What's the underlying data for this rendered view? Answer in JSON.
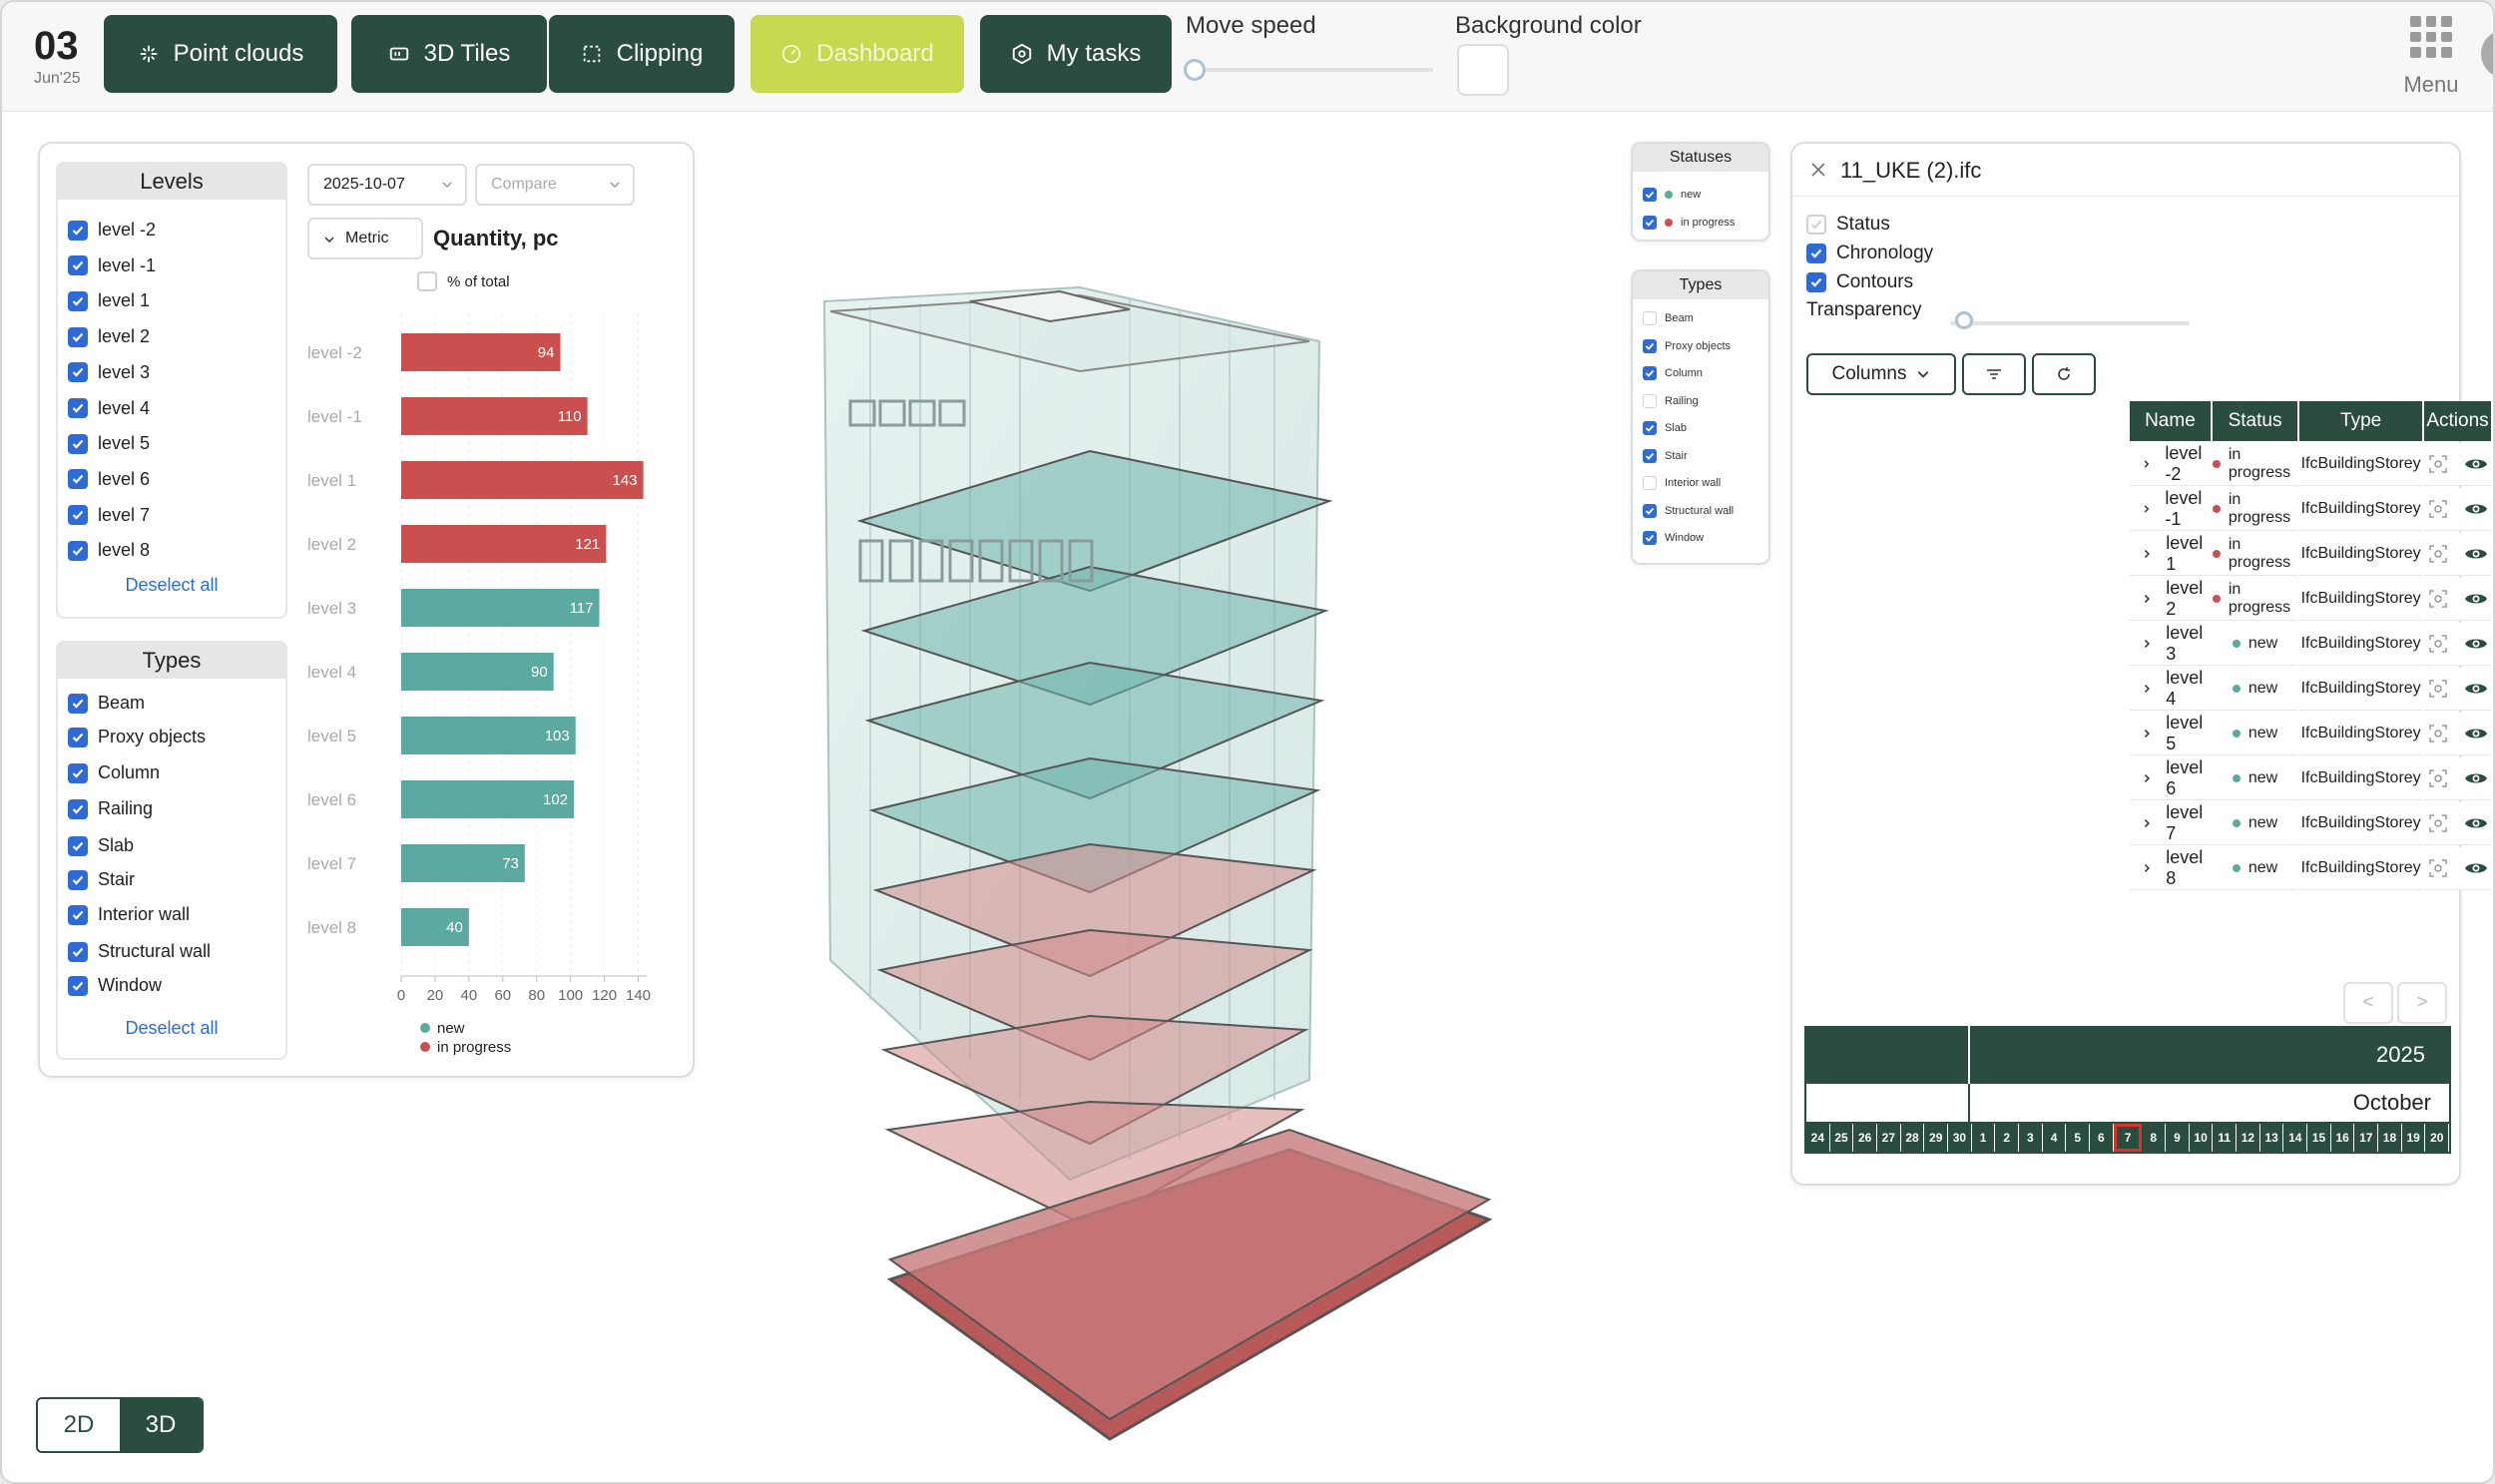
{
  "header": {
    "date_day": "03",
    "date_sub": "Jun'25",
    "nav": [
      {
        "label": "Point clouds",
        "icon": "point-clouds-icon"
      },
      {
        "label": "3D Tiles",
        "icon": "tiles-icon"
      },
      {
        "label": "Clipping",
        "icon": "clipping-icon"
      },
      {
        "label": "Dashboard",
        "icon": "dashboard-icon",
        "active": true
      },
      {
        "label": "My tasks",
        "icon": "tasks-icon"
      }
    ],
    "move_speed_label": "Move speed",
    "move_speed_value": 0.0,
    "background_color_label": "Background color",
    "background_color_value": "#ffffff",
    "menu_label": "Menu"
  },
  "colors": {
    "dark_green": "#2a4d3f",
    "lime": "#c8d94f",
    "new": "#5ba9a0",
    "in_progress": "#c9504f",
    "checkbox": "#2f6bd6"
  },
  "levels_panel": {
    "title": "Levels",
    "items": [
      "level -2",
      "level -1",
      "level 1",
      "level 2",
      "level 3",
      "level 4",
      "level 5",
      "level 6",
      "level 7",
      "level 8"
    ],
    "deselect_label": "Deselect all"
  },
  "types_panel": {
    "title": "Types",
    "items": [
      "Beam",
      "Proxy objects",
      "Column",
      "Railing",
      "Slab",
      "Stair",
      "Interior wall",
      "Structural wall",
      "Window"
    ],
    "deselect_label": "Deselect all"
  },
  "dashboard": {
    "date_value": "2025-10-07",
    "compare_placeholder": "Compare",
    "metric_label": "Metric",
    "metric_title": "Quantity, pc",
    "percent_label": "% of total"
  },
  "chart_data": {
    "type": "bar",
    "orientation": "horizontal",
    "categories": [
      "level -2",
      "level -1",
      "level 1",
      "level 2",
      "level 3",
      "level 4",
      "level 5",
      "level 6",
      "level 7",
      "level 8"
    ],
    "values": [
      94,
      110,
      143,
      121,
      117,
      90,
      103,
      102,
      73,
      40
    ],
    "status": [
      "in progress",
      "in progress",
      "in progress",
      "in progress",
      "new",
      "new",
      "new",
      "new",
      "new",
      "new"
    ],
    "xticks": [
      0,
      20,
      40,
      60,
      80,
      100,
      120,
      140
    ],
    "xlim": [
      0,
      145
    ],
    "grid": true,
    "legend": [
      {
        "name": "new",
        "color": "#5ba9a0"
      },
      {
        "name": "in progress",
        "color": "#c9504f"
      }
    ],
    "legend_position": "bottom-left",
    "title": "Quantity, pc"
  },
  "statuses_panel": {
    "title": "Statuses",
    "items": [
      {
        "label": "new",
        "color": "#5ba9a0"
      },
      {
        "label": "in progress",
        "color": "#c9504f"
      }
    ]
  },
  "types_filter_panel": {
    "title": "Types",
    "items": [
      {
        "label": "Beam",
        "checked": false
      },
      {
        "label": "Proxy objects",
        "checked": true
      },
      {
        "label": "Column",
        "checked": true
      },
      {
        "label": "Railing",
        "checked": false
      },
      {
        "label": "Slab",
        "checked": true
      },
      {
        "label": "Stair",
        "checked": true
      },
      {
        "label": "Interior wall",
        "checked": false
      },
      {
        "label": "Structural wall",
        "checked": true
      },
      {
        "label": "Window",
        "checked": true
      }
    ]
  },
  "details_panel": {
    "file_name": "11_UKE (2).ifc",
    "toggles": [
      {
        "label": "Status",
        "checked": false
      },
      {
        "label": "Chronology",
        "checked": true
      },
      {
        "label": "Contours",
        "checked": true
      }
    ],
    "transparency_label": "Transparency",
    "transparency_value": 0.06,
    "columns_button": "Columns",
    "table": {
      "headers": [
        "Name",
        "Status",
        "Type",
        "Actions"
      ],
      "rows": [
        {
          "name": "level -2",
          "status": "in progress",
          "type": "IfcBuildingStorey"
        },
        {
          "name": "level -1",
          "status": "in progress",
          "type": "IfcBuildingStorey"
        },
        {
          "name": "level 1",
          "status": "in progress",
          "type": "IfcBuildingStorey"
        },
        {
          "name": "level 2",
          "status": "in progress",
          "type": "IfcBuildingStorey"
        },
        {
          "name": "level 3",
          "status": "new",
          "type": "IfcBuildingStorey"
        },
        {
          "name": "level 4",
          "status": "new",
          "type": "IfcBuildingStorey"
        },
        {
          "name": "level 5",
          "status": "new",
          "type": "IfcBuildingStorey"
        },
        {
          "name": "level 6",
          "status": "new",
          "type": "IfcBuildingStorey"
        },
        {
          "name": "level 7",
          "status": "new",
          "type": "IfcBuildingStorey"
        },
        {
          "name": "level 8",
          "status": "new",
          "type": "IfcBuildingStorey"
        }
      ]
    },
    "pager_prev": "<",
    "pager_next": ">",
    "timeline": {
      "year": "2025",
      "month": "October",
      "days": [
        "24",
        "25",
        "26",
        "27",
        "28",
        "29",
        "30",
        "1",
        "2",
        "3",
        "4",
        "5",
        "6",
        "7",
        "8",
        "9",
        "10",
        "11",
        "12",
        "13",
        "14",
        "15",
        "16",
        "17",
        "18",
        "19",
        "20"
      ],
      "selected_day": "7"
    }
  },
  "view_toggle": {
    "left": "2D",
    "right": "3D",
    "active": "3D"
  }
}
